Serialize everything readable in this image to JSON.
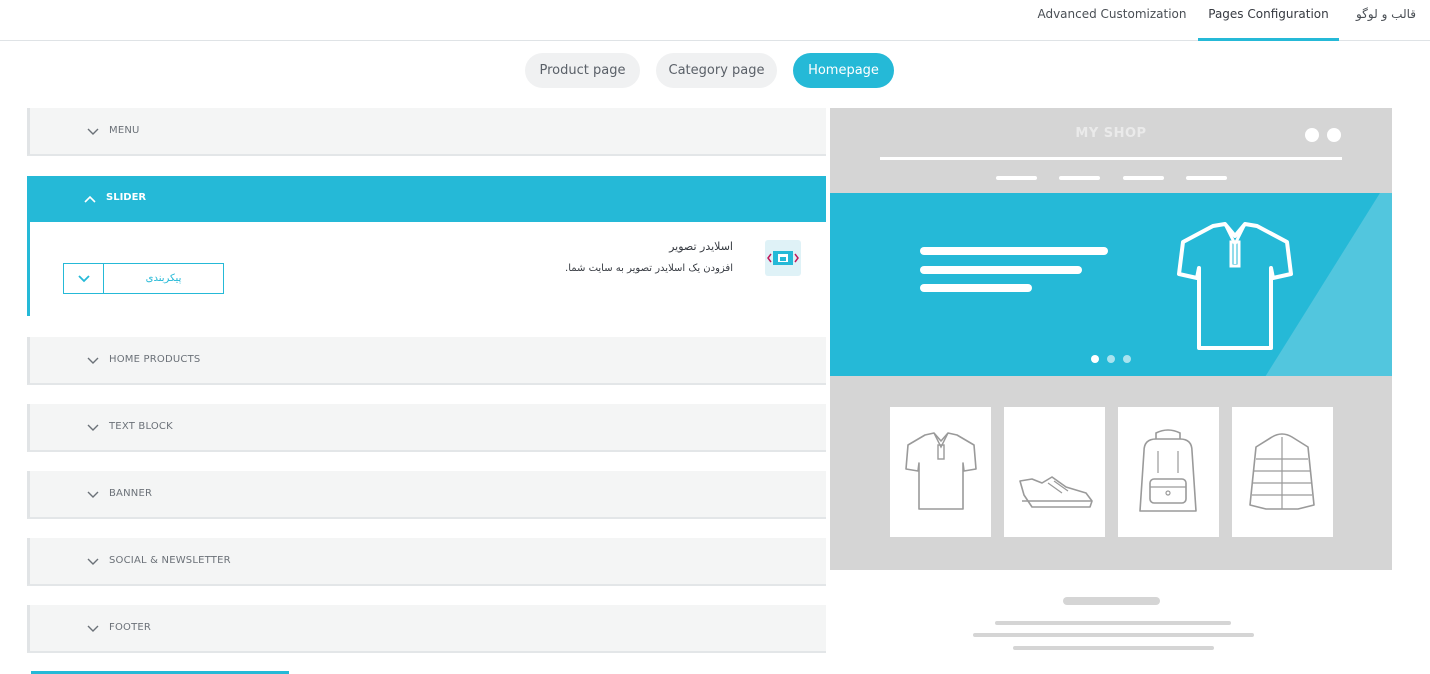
{
  "top_tabs": [
    {
      "label": "Advanced Customization",
      "active": false
    },
    {
      "label": "Pages Configuration",
      "active": true
    },
    {
      "label": "قالب و لوگو",
      "active": false
    }
  ],
  "page_tabs": [
    {
      "label": "Product page",
      "active": false
    },
    {
      "label": "Category page",
      "active": false
    },
    {
      "label": "Homepage",
      "active": true
    }
  ],
  "sections": {
    "menu": "MENU",
    "slider": "SLIDER",
    "home_products": "HOME PRODUCTS",
    "text_block": "TEXT BLOCK",
    "banner": "BANNER",
    "social": "SOCIAL & NEWSLETTER",
    "footer": "FOOTER"
  },
  "slider_module": {
    "title": "اسلایدر تصویر",
    "description": "افزودن یک اسلایدر تصویر به سایت شما.",
    "configure_label": "پیکربندی"
  },
  "preview": {
    "shop_name": "MY SHOP"
  },
  "colors": {
    "accent": "#25b9d7",
    "preview_bg": "#d5d5d5"
  }
}
